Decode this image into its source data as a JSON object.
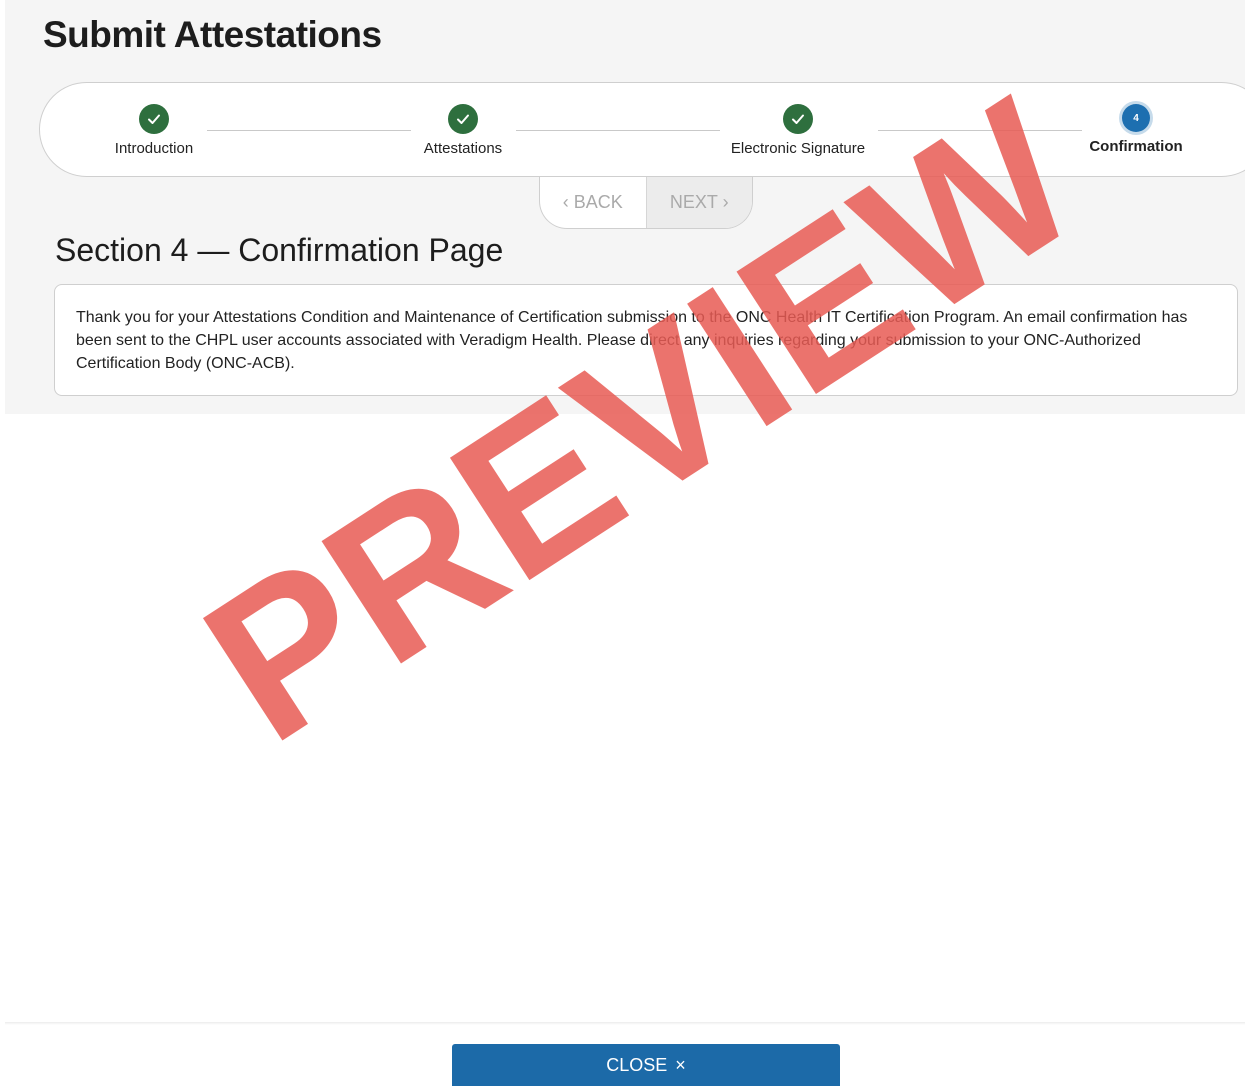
{
  "page": {
    "title": "Submit Attestations"
  },
  "stepper": {
    "steps": [
      {
        "label": "Introduction",
        "status": "complete",
        "icon": "check-icon"
      },
      {
        "label": "Attestations",
        "status": "complete",
        "icon": "check-icon"
      },
      {
        "label": "Electronic Signature",
        "status": "complete",
        "icon": "check-icon"
      },
      {
        "label": "Confirmation",
        "status": "current",
        "number": "4"
      }
    ]
  },
  "navigation": {
    "back_label": "‹ BACK",
    "next_label": "NEXT ›"
  },
  "section": {
    "title": "Section 4 — Confirmation Page",
    "message": "Thank you for your Attestations Condition and Maintenance of Certification submission to the ONC Health IT Certification Program. An email confirmation has been sent to the CHPL user accounts associated with Veradigm Health. Please direct any inquiries regarding your submission to your ONC-Authorized Certification Body (ONC-ACB)."
  },
  "footer": {
    "close_label": "CLOSE",
    "close_icon": "×"
  },
  "watermark": {
    "text": "PREVIEW",
    "color": "#e85a54"
  },
  "colors": {
    "complete": "#2e6f3e",
    "active": "#1d6fb0",
    "primary_button": "#1c6aa8"
  }
}
